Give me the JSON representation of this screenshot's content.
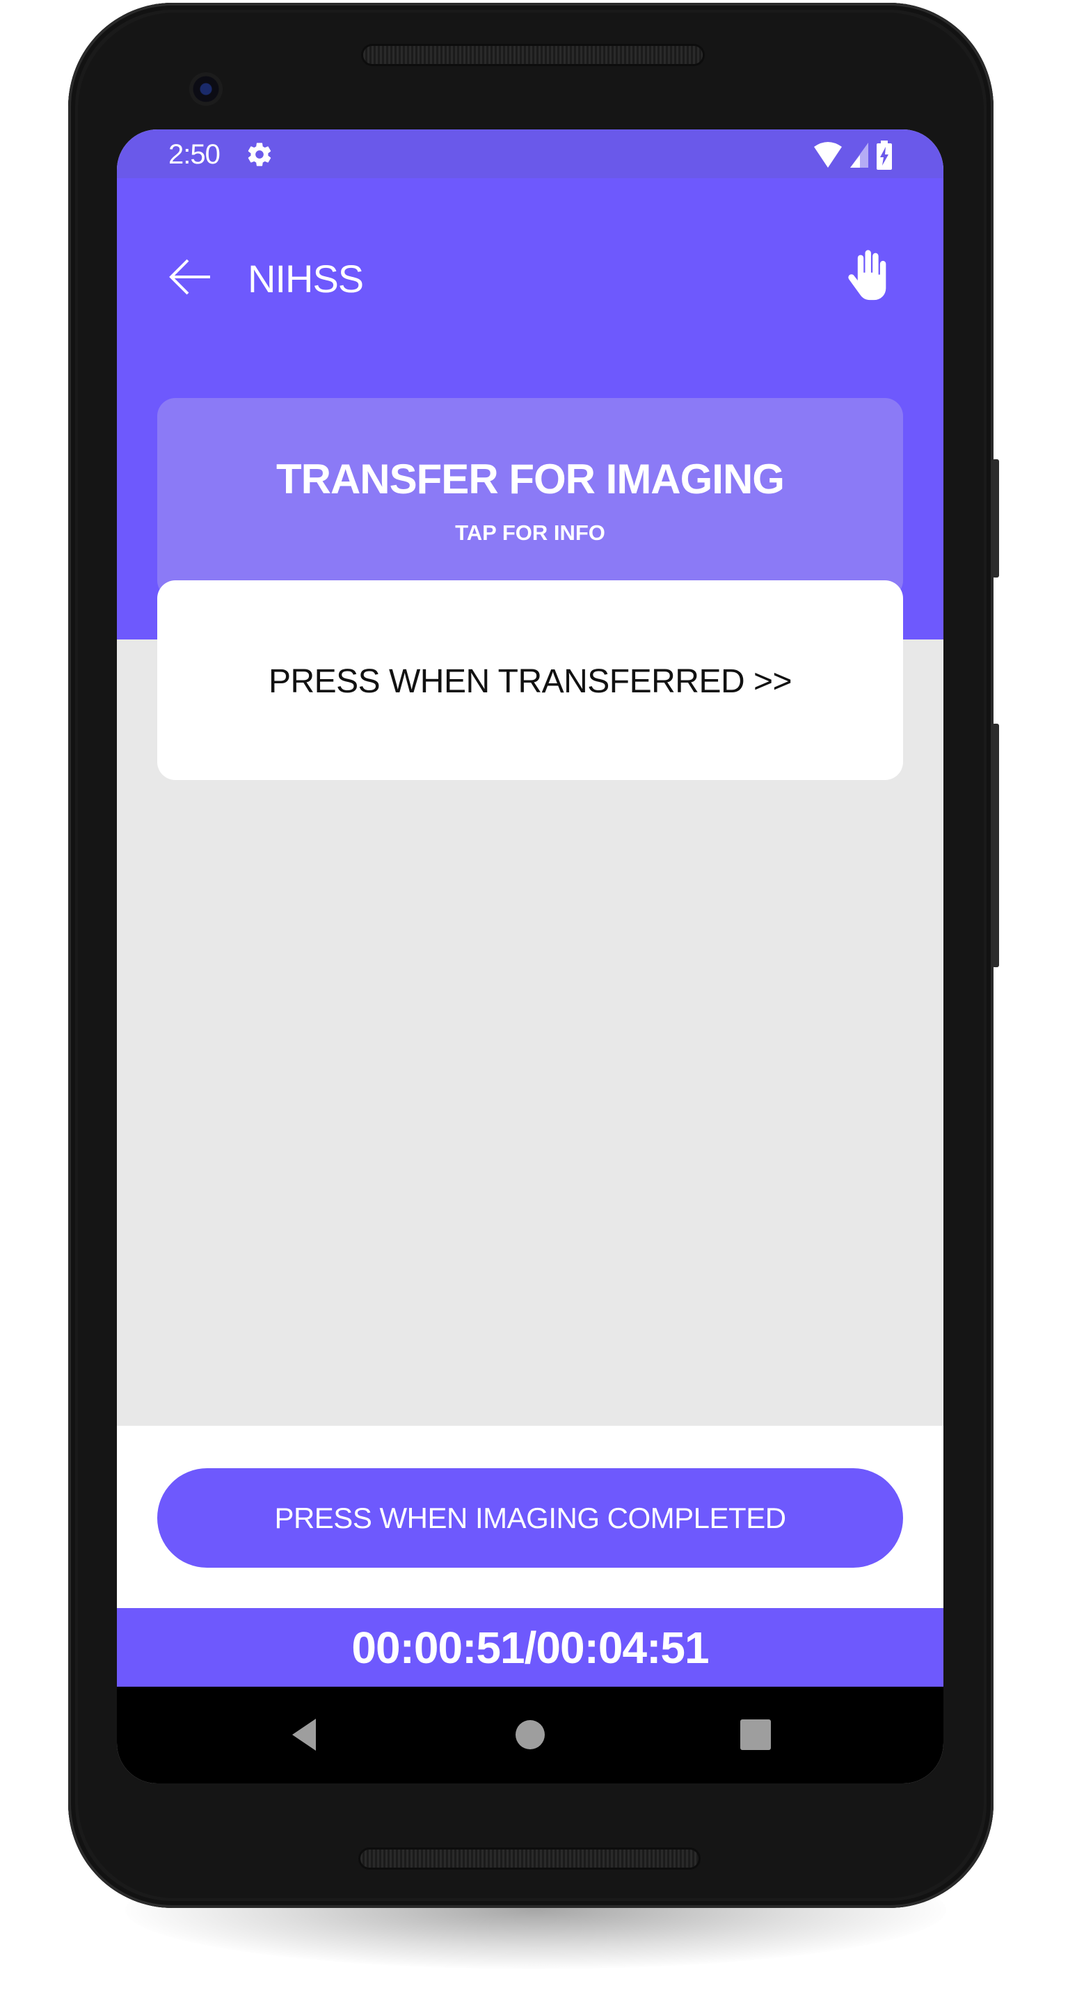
{
  "status_bar": {
    "time": "2:50",
    "icons": [
      "gear-icon",
      "wifi-icon",
      "signal-icon",
      "battery-charging-icon"
    ]
  },
  "app_bar": {
    "back_icon": "arrow-left-icon",
    "title": "NIHSS",
    "action_icon": "hand-stop-icon"
  },
  "info_card": {
    "title": "TRANSFER FOR IMAGING",
    "subtitle": "TAP FOR INFO"
  },
  "action_card": {
    "label": "PRESS WHEN TRANSFERRED >>"
  },
  "complete_button": {
    "label": "PRESS WHEN IMAGING COMPLETED"
  },
  "timer": {
    "text": "00:00:51/00:04:51"
  },
  "nav_bar": {
    "buttons": [
      "back-triangle-icon",
      "home-circle-icon",
      "recents-square-icon"
    ]
  },
  "colors": {
    "primary": "#6e59fd",
    "status_bar": "#6a59ea",
    "info_card": "#8b7af6",
    "background": "#e8e8e8"
  }
}
